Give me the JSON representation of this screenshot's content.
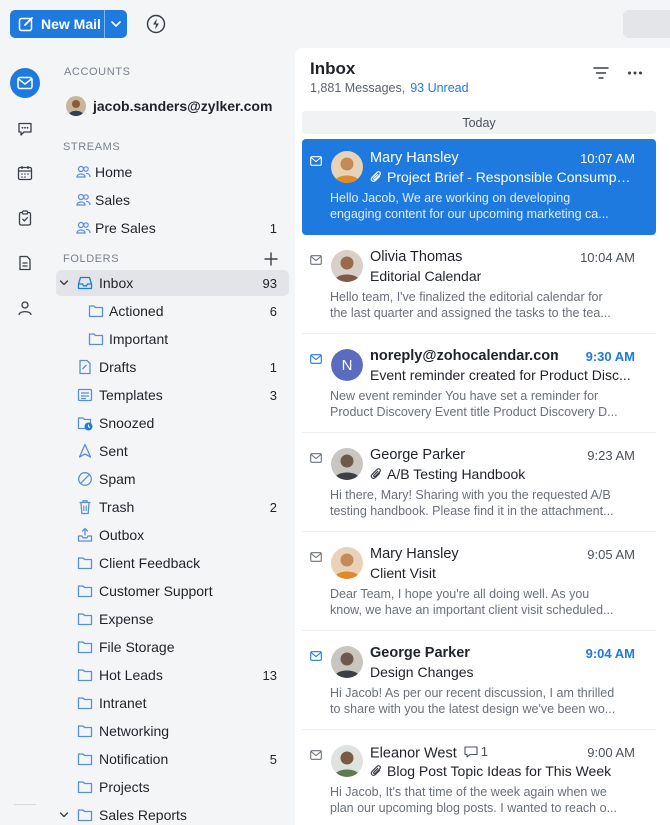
{
  "toolbar": {
    "new_mail_label": "New Mail"
  },
  "panel": {
    "accounts_header": "ACCOUNTS",
    "account_email": "jacob.sanders@zylker.com",
    "streams_header": "STREAMS",
    "streams": [
      {
        "label": "Home",
        "count": ""
      },
      {
        "label": "Sales",
        "count": ""
      },
      {
        "label": "Pre Sales",
        "count": "1"
      }
    ],
    "folders_header": "FOLDERS",
    "folders": [
      {
        "label": "Inbox",
        "count": "93",
        "icon": "inbox-icon"
      },
      {
        "label": "Actioned",
        "count": "6",
        "icon": "folder-icon"
      },
      {
        "label": "Important",
        "count": "",
        "icon": "folder-icon"
      },
      {
        "label": "Drafts",
        "count": "1",
        "icon": "drafts-icon"
      },
      {
        "label": "Templates",
        "count": "3",
        "icon": "templates-icon"
      },
      {
        "label": "Snoozed",
        "count": "",
        "icon": "snoozed-icon"
      },
      {
        "label": "Sent",
        "count": "",
        "icon": "sent-icon"
      },
      {
        "label": "Spam",
        "count": "",
        "icon": "spam-icon"
      },
      {
        "label": "Trash",
        "count": "2",
        "icon": "trash-icon"
      },
      {
        "label": "Outbox",
        "count": "",
        "icon": "outbox-icon"
      },
      {
        "label": "Client Feedback",
        "count": "",
        "icon": "folder-icon"
      },
      {
        "label": "Customer Support",
        "count": "",
        "icon": "folder-icon"
      },
      {
        "label": "Expense",
        "count": "",
        "icon": "folder-icon"
      },
      {
        "label": "File Storage",
        "count": "",
        "icon": "folder-icon"
      },
      {
        "label": "Hot Leads",
        "count": "13",
        "icon": "folder-icon"
      },
      {
        "label": "Intranet",
        "count": "",
        "icon": "folder-icon"
      },
      {
        "label": "Networking",
        "count": "",
        "icon": "folder-icon"
      },
      {
        "label": "Notification",
        "count": "5",
        "icon": "folder-icon"
      },
      {
        "label": "Projects",
        "count": "",
        "icon": "folder-icon"
      },
      {
        "label": "Sales Reports",
        "count": "",
        "icon": "folder-icon"
      }
    ]
  },
  "list": {
    "title": "Inbox",
    "message_count": "1,881 Messages,",
    "unread_count": "93 Unread",
    "group_today": "Today",
    "messages": [
      {
        "sender": "Mary Hansley",
        "time": "10:07 AM",
        "subject": "Project Brief - Responsible Consumpt...",
        "preview1": "Hello Jacob, We are working on developing",
        "preview2": "engaging content for our upcoming marketing ca...",
        "attachment": true,
        "unread": false,
        "selected": true
      },
      {
        "sender": "Olivia Thomas",
        "time": "10:04 AM",
        "subject": "Editorial Calendar",
        "preview1": "Hello team, I've finalized the editorial calendar for",
        "preview2": "the last quarter and assigned the tasks to the tea...",
        "attachment": false,
        "unread": false,
        "selected": false
      },
      {
        "sender": "noreply@zohocalendar.com",
        "initial": "N",
        "time": "9:30 AM",
        "subject": "Event reminder created for Product Disc...",
        "preview1": "New event reminder You have set a reminder for",
        "preview2": "Product Discovery Event title Product Discovery D...",
        "attachment": false,
        "unread": true,
        "selected": false
      },
      {
        "sender": "George Parker",
        "time": "9:23 AM",
        "subject": "A/B Testing Handbook",
        "preview1": "Hi there, Mary! Sharing with you the requested A/B",
        "preview2": "testing handbook. Please find it in the attachment...",
        "attachment": true,
        "unread": false,
        "selected": false
      },
      {
        "sender": "Mary Hansley",
        "time": "9:05 AM",
        "subject": "Client Visit",
        "preview1": "Dear Team, I hope you're all doing well. As you",
        "preview2": "know, we have an important client visit scheduled...",
        "attachment": false,
        "unread": false,
        "selected": false
      },
      {
        "sender": "George Parker",
        "time": "9:04 AM",
        "subject": "Design Changes",
        "preview1": "Hi Jacob! As per our recent discussion, I am thrilled",
        "preview2": "to share with you the latest design we've been wo...",
        "attachment": false,
        "unread": true,
        "selected": false
      },
      {
        "sender": "Eleanor West",
        "thread_count": "1",
        "time": "9:00 AM",
        "subject": "Blog Post Topic Ideas for This Week",
        "preview1": "Hi Jacob, It's that time of the week again when we",
        "preview2": "plan our upcoming blog posts. I wanted to reach o...",
        "attachment": true,
        "unread": false,
        "selected": false
      }
    ]
  },
  "colors": {
    "accent": "#1f7ae0",
    "panel_bg": "#f4f5f7",
    "selected_row": "#e2e4e8"
  }
}
